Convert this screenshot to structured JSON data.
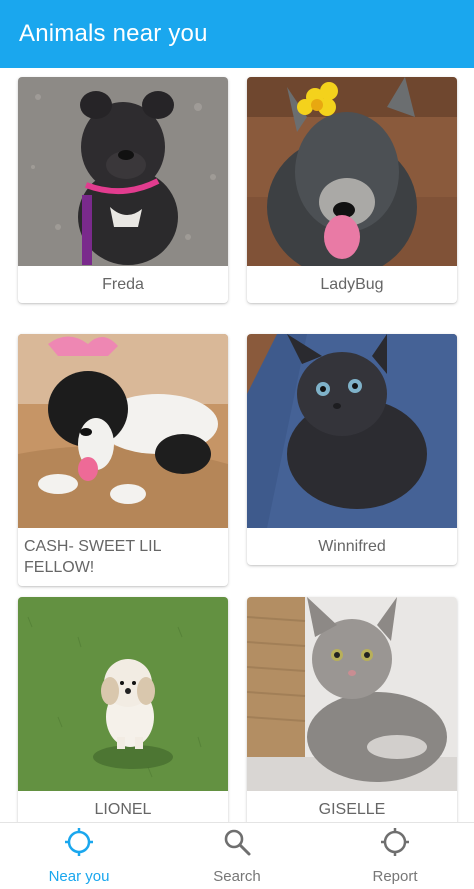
{
  "header": {
    "title": "Animals near you"
  },
  "animals": [
    {
      "name": "Freda"
    },
    {
      "name": "LadyBug"
    },
    {
      "name": "CASH- SWEET LIL FELLOW!"
    },
    {
      "name": "Winnifred"
    },
    {
      "name": "LIONEL"
    },
    {
      "name": "GISELLE"
    }
  ],
  "nav": {
    "items": [
      {
        "label": "Near you",
        "icon": "crosshair-icon",
        "active": true
      },
      {
        "label": "Search",
        "icon": "search-icon",
        "active": false
      },
      {
        "label": "Report",
        "icon": "crosshair-icon",
        "active": false
      }
    ]
  },
  "colors": {
    "accent": "#1aa7ee",
    "inactive": "#777777"
  }
}
